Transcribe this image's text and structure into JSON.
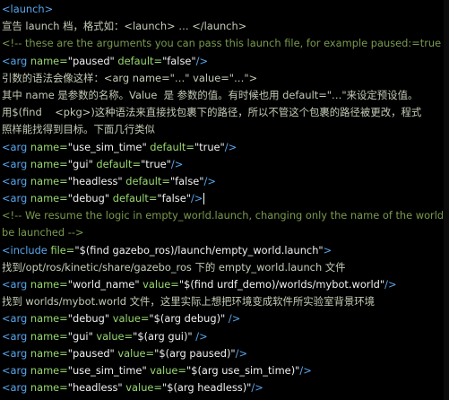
{
  "editor": {
    "lines": [
      {
        "tokens": [
          {
            "t": "<launch>",
            "c": "c-tag"
          }
        ]
      },
      {
        "tokens": [
          {
            "t": "宣告 launch 档，格式如：<launch> … </launch>",
            "c": "c-cn"
          }
        ]
      },
      {
        "tokens": [
          {
            "t": "<!-- these are the arguments you can pass this launch file, for example paused:=true -->",
            "c": "c-comment"
          }
        ]
      },
      {
        "tokens": [
          {
            "t": "<arg",
            "c": "c-tag"
          },
          {
            "t": " name=",
            "c": "c-attr"
          },
          {
            "t": "\"paused\"",
            "c": "c-str"
          },
          {
            "t": " default=",
            "c": "c-attr"
          },
          {
            "t": "\"false\"",
            "c": "c-str"
          },
          {
            "t": "/>",
            "c": "c-tag"
          }
        ]
      },
      {
        "tokens": [
          {
            "t": "引数的语法会像这样：<arg name=\"…\" value=\"…\">",
            "c": "c-cn"
          }
        ]
      },
      {
        "tokens": [
          {
            "t": "其中 name 是参数的名称。Value  是 参数的值。有时候也用 default=\"…\"来设定预设值。",
            "c": "c-cn"
          }
        ]
      },
      {
        "tokens": [
          {
            "t": "用$(find    <pkg>)这种语法来直接找包裹下的路径，所以不管这个包裹的路径被更改，程式",
            "c": "c-cn"
          }
        ]
      },
      {
        "tokens": [
          {
            "t": "照样能找得到目标。下面几行类似",
            "c": "c-cn"
          }
        ]
      },
      {
        "tokens": [
          {
            "t": "<arg",
            "c": "c-tag"
          },
          {
            "t": " name=",
            "c": "c-attr"
          },
          {
            "t": "\"use_sim_time\"",
            "c": "c-str"
          },
          {
            "t": " default=",
            "c": "c-attr"
          },
          {
            "t": "\"true\"",
            "c": "c-str"
          },
          {
            "t": "/>",
            "c": "c-tag"
          }
        ]
      },
      {
        "tokens": [
          {
            "t": "<arg",
            "c": "c-tag"
          },
          {
            "t": " name=",
            "c": "c-attr"
          },
          {
            "t": "\"gui\"",
            "c": "c-str"
          },
          {
            "t": " default=",
            "c": "c-attr"
          },
          {
            "t": "\"true\"",
            "c": "c-str"
          },
          {
            "t": "/>",
            "c": "c-tag"
          }
        ]
      },
      {
        "tokens": [
          {
            "t": "<arg",
            "c": "c-tag"
          },
          {
            "t": " name=",
            "c": "c-attr"
          },
          {
            "t": "\"headless\"",
            "c": "c-str"
          },
          {
            "t": " default=",
            "c": "c-attr"
          },
          {
            "t": "\"false\"",
            "c": "c-str"
          },
          {
            "t": "/>",
            "c": "c-tag"
          }
        ]
      },
      {
        "tokens": [
          {
            "t": "<arg",
            "c": "c-tag"
          },
          {
            "t": " name=",
            "c": "c-attr"
          },
          {
            "t": "\"debug\"",
            "c": "c-str"
          },
          {
            "t": " default=",
            "c": "c-attr"
          },
          {
            "t": "\"false\"",
            "c": "c-str"
          },
          {
            "t": "/>",
            "c": "c-tag"
          }
        ],
        "caret": true
      },
      {
        "tokens": [
          {
            "t": "<!-- We resume the logic in empty_world.launch, changing only the name of the world to",
            "c": "c-comment"
          }
        ]
      },
      {
        "tokens": [
          {
            "t": "be launched -->",
            "c": "c-comment"
          }
        ]
      },
      {
        "tokens": [
          {
            "t": "<include",
            "c": "c-tag"
          },
          {
            "t": " file=",
            "c": "c-attr"
          },
          {
            "t": "\"$(find gazebo_ros)/launch/empty_world.launch\"",
            "c": "c-str"
          },
          {
            "t": ">",
            "c": "c-tag"
          }
        ]
      },
      {
        "tokens": [
          {
            "t": "找到/opt/ros/kinetic/share/gazebo_ros 下的 empty_world.launch 文件",
            "c": "c-cn"
          }
        ]
      },
      {
        "tokens": [
          {
            "t": "<arg",
            "c": "c-tag"
          },
          {
            "t": " name=",
            "c": "c-attr"
          },
          {
            "t": "\"world_name\"",
            "c": "c-str"
          },
          {
            "t": " value=",
            "c": "c-attr"
          },
          {
            "t": "\"$(find urdf_demo)/worlds/mybot.world\"",
            "c": "c-str"
          },
          {
            "t": "/>",
            "c": "c-tag"
          }
        ]
      },
      {
        "tokens": [
          {
            "t": "找到 worlds/mybot.world 文件，这里实际上想把环境变成软件所实验室背景环境",
            "c": "c-cn"
          }
        ]
      },
      {
        "tokens": [
          {
            "t": "<arg",
            "c": "c-tag"
          },
          {
            "t": " name=",
            "c": "c-attr"
          },
          {
            "t": "\"debug\"",
            "c": "c-str"
          },
          {
            "t": " value=",
            "c": "c-attr"
          },
          {
            "t": "\"$(arg debug)\"",
            "c": "c-str"
          },
          {
            "t": " />",
            "c": "c-tag"
          }
        ]
      },
      {
        "tokens": [
          {
            "t": "<arg",
            "c": "c-tag"
          },
          {
            "t": " name=",
            "c": "c-attr"
          },
          {
            "t": "\"gui\"",
            "c": "c-str"
          },
          {
            "t": " value=",
            "c": "c-attr"
          },
          {
            "t": "\"$(arg gui)\"",
            "c": "c-str"
          },
          {
            "t": " />",
            "c": "c-tag"
          }
        ]
      },
      {
        "tokens": [
          {
            "t": "<arg",
            "c": "c-tag"
          },
          {
            "t": " name=",
            "c": "c-attr"
          },
          {
            "t": "\"paused\"",
            "c": "c-str"
          },
          {
            "t": " value=",
            "c": "c-attr"
          },
          {
            "t": "\"$(arg paused)\"",
            "c": "c-str"
          },
          {
            "t": "/>",
            "c": "c-tag"
          }
        ]
      },
      {
        "tokens": [
          {
            "t": "<arg",
            "c": "c-tag"
          },
          {
            "t": " name=",
            "c": "c-attr"
          },
          {
            "t": "\"use_sim_time\"",
            "c": "c-str"
          },
          {
            "t": " value=",
            "c": "c-attr"
          },
          {
            "t": "\"$(arg use_sim_time)\"",
            "c": "c-str"
          },
          {
            "t": "/>",
            "c": "c-tag"
          }
        ]
      },
      {
        "tokens": [
          {
            "t": "<arg",
            "c": "c-tag"
          },
          {
            "t": " name=",
            "c": "c-attr"
          },
          {
            "t": "\"headless\"",
            "c": "c-str"
          },
          {
            "t": " value=",
            "c": "c-attr"
          },
          {
            "t": "\"$(arg headless)\"",
            "c": "c-str"
          },
          {
            "t": "/>",
            "c": "c-tag"
          }
        ]
      }
    ]
  }
}
